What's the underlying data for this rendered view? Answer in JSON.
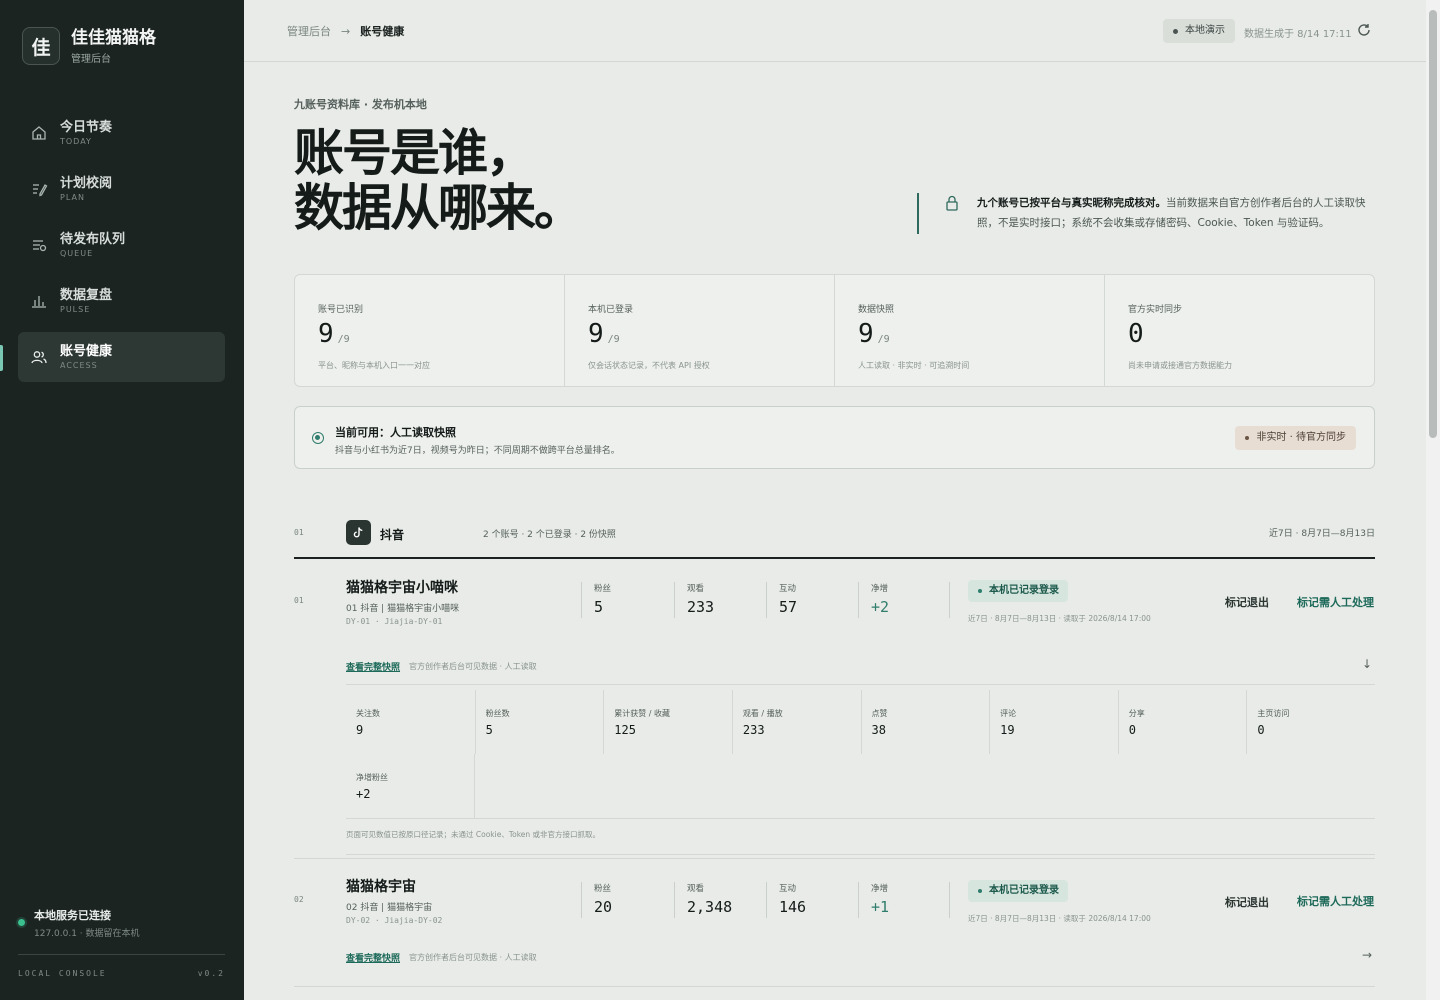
{
  "brand": {
    "logo_char": "佳",
    "title": "佳佳猫猫格",
    "subtitle": "管理后台"
  },
  "nav": [
    {
      "label": "今日节奏",
      "en": "TODAY",
      "icon": "home-icon"
    },
    {
      "label": "计划校阅",
      "en": "PLAN",
      "icon": "edit-list-icon"
    },
    {
      "label": "待发布队列",
      "en": "QUEUE",
      "icon": "queue-icon"
    },
    {
      "label": "数据复盘",
      "en": "PULSE",
      "icon": "bar-chart-icon"
    },
    {
      "label": "账号健康",
      "en": "ACCESS",
      "icon": "users-icon",
      "active": true
    }
  ],
  "service": {
    "title": "本地服务已连接",
    "subtitle": "127.0.0.1 · 数据留在本机"
  },
  "footer": {
    "left": "LOCAL CONSOLE",
    "right": "v0.2"
  },
  "topbar": {
    "crumb_root": "管理后台",
    "crumb_sep": "→",
    "crumb_current": "账号健康",
    "local_badge": "本地演示",
    "generated": "数据生成于 8/14 17:11"
  },
  "page": {
    "eyebrow": "九账号资料库 · 发布机本地",
    "hero_line1": "账号是谁，",
    "hero_line2": "数据从哪来。",
    "notice_bold": "九个账号已按平台与真实昵称完成核对。",
    "notice_rest": "当前数据来自官方创作者后台的人工读取快照，不是实时接口；系统不会收集或存储密码、Cookie、Token 与验证码。"
  },
  "stats": [
    {
      "label": "账号已识别",
      "value": "9",
      "suffix": "/9",
      "desc": "平台、昵称与本机入口一一对应"
    },
    {
      "label": "本机已登录",
      "value": "9",
      "suffix": "/9",
      "desc": "仅会话状态记录，不代表 API 授权"
    },
    {
      "label": "数据快照",
      "value": "9",
      "suffix": "/9",
      "desc": "人工读取 · 非实时 · 可追溯时间"
    },
    {
      "label": "官方实时同步",
      "value": "0",
      "suffix": "",
      "desc": "尚未申请或接通官方数据能力"
    }
  ],
  "availability": {
    "title": "当前可用：人工读取快照",
    "desc": "抖音与小红书为近7日，视频号为昨日；不同周期不做跨平台总量排名。",
    "badge": "非实时 · 待官方同步"
  },
  "platform": {
    "index": "01",
    "icon": "tiktok-icon",
    "name": "抖音",
    "meta": "2 个账号 · 2 个已登录 · 2 份快照",
    "range": "近7日 · 8月7日—8月13日"
  },
  "accounts": [
    {
      "index": "01",
      "name": "猫猫格宇宙小喵咪",
      "sub": "01 抖音 | 猫猫格宇宙小喵咪",
      "id": "DY-01 · Jiajia-DY-01",
      "metrics": [
        {
          "label": "粉丝",
          "value": "5"
        },
        {
          "label": "观看",
          "value": "233"
        },
        {
          "label": "互动",
          "value": "57"
        },
        {
          "label": "净增",
          "value": "+2",
          "positive": true
        }
      ],
      "login_badge": "本机已记录登录",
      "login_meta": "近7日 · 8月7日—8月13日 · 读取于 2026/8/14 17:00",
      "action_logout": "标记退出",
      "action_manual": "标记需人工处理",
      "snap_link": "查看完整快照",
      "snap_note": "官方创作者后台可见数据 · 人工读取",
      "snap_arrow": "↓"
    },
    {
      "index": "02",
      "name": "猫猫格宇宙",
      "sub": "02 抖音 | 猫猫格宇宙",
      "id": "DY-02 · Jiajia-DY-02",
      "metrics": [
        {
          "label": "粉丝",
          "value": "20"
        },
        {
          "label": "观看",
          "value": "2,348"
        },
        {
          "label": "互动",
          "value": "146"
        },
        {
          "label": "净增",
          "value": "+1",
          "positive": true
        }
      ],
      "login_badge": "本机已记录登录",
      "login_meta": "近7日 · 8月7日—8月13日 · 读取于 2026/8/14 17:00",
      "action_logout": "标记退出",
      "action_manual": "标记需人工处理",
      "snap_link": "查看完整快照",
      "snap_note": "官方创作者后台可见数据 · 人工读取",
      "snap_arrow": "→"
    }
  ],
  "detail": {
    "cells": [
      {
        "label": "关注数",
        "value": "9"
      },
      {
        "label": "粉丝数",
        "value": "5"
      },
      {
        "label": "累计获赞 / 收藏",
        "value": "125"
      },
      {
        "label": "观看 / 播放",
        "value": "233"
      },
      {
        "label": "点赞",
        "value": "38"
      },
      {
        "label": "评论",
        "value": "19"
      },
      {
        "label": "分享",
        "value": "0"
      },
      {
        "label": "主页访问",
        "value": "0"
      },
      {
        "label": "净增粉丝",
        "value": "+2"
      }
    ],
    "note": "页面可见数值已按原口径记录；未通过 Cookie、Token 或非官方接口抓取。"
  }
}
